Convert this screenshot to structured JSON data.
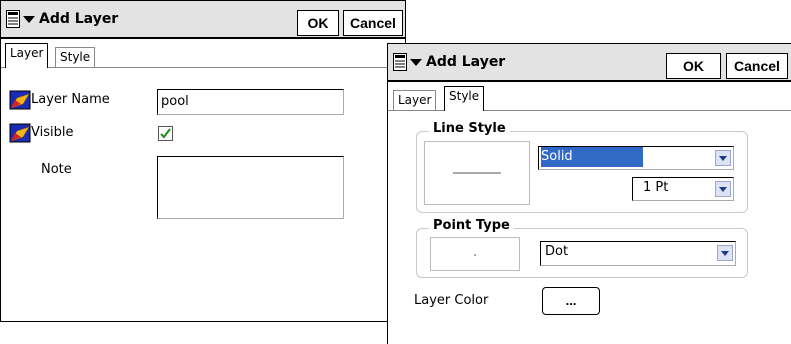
{
  "dialog_layer": {
    "title": "Add Layer",
    "ok_label": "OK",
    "cancel_label": "Cancel",
    "tabs": [
      {
        "label": "Layer"
      },
      {
        "label": "Style"
      }
    ],
    "active_tab": "Layer",
    "layer_name_label": "Layer Name",
    "layer_name_value": "pool",
    "visible_label": "Visible",
    "visible_checked": true,
    "note_label": "Note",
    "note_value": ""
  },
  "dialog_style": {
    "title": "Add Layer",
    "ok_label": "OK",
    "cancel_label": "Cancel",
    "tabs": [
      {
        "label": "Layer"
      },
      {
        "label": "Style"
      }
    ],
    "active_tab": "Style",
    "line_style_title": "Line Style",
    "line_style_value": "Solid",
    "line_width_value": "1 Pt",
    "point_type_title": "Point Type",
    "point_type_value": "Dot",
    "layer_color_label": "Layer Color",
    "layer_color_button": "..."
  },
  "icons": {
    "menu": "menu-icon",
    "layer_row": "layer-icon",
    "checkmark_color": "#1a8c1a"
  },
  "colors": {
    "selection_highlight": "#3169c6",
    "titlebar": "#e3e3e3"
  }
}
